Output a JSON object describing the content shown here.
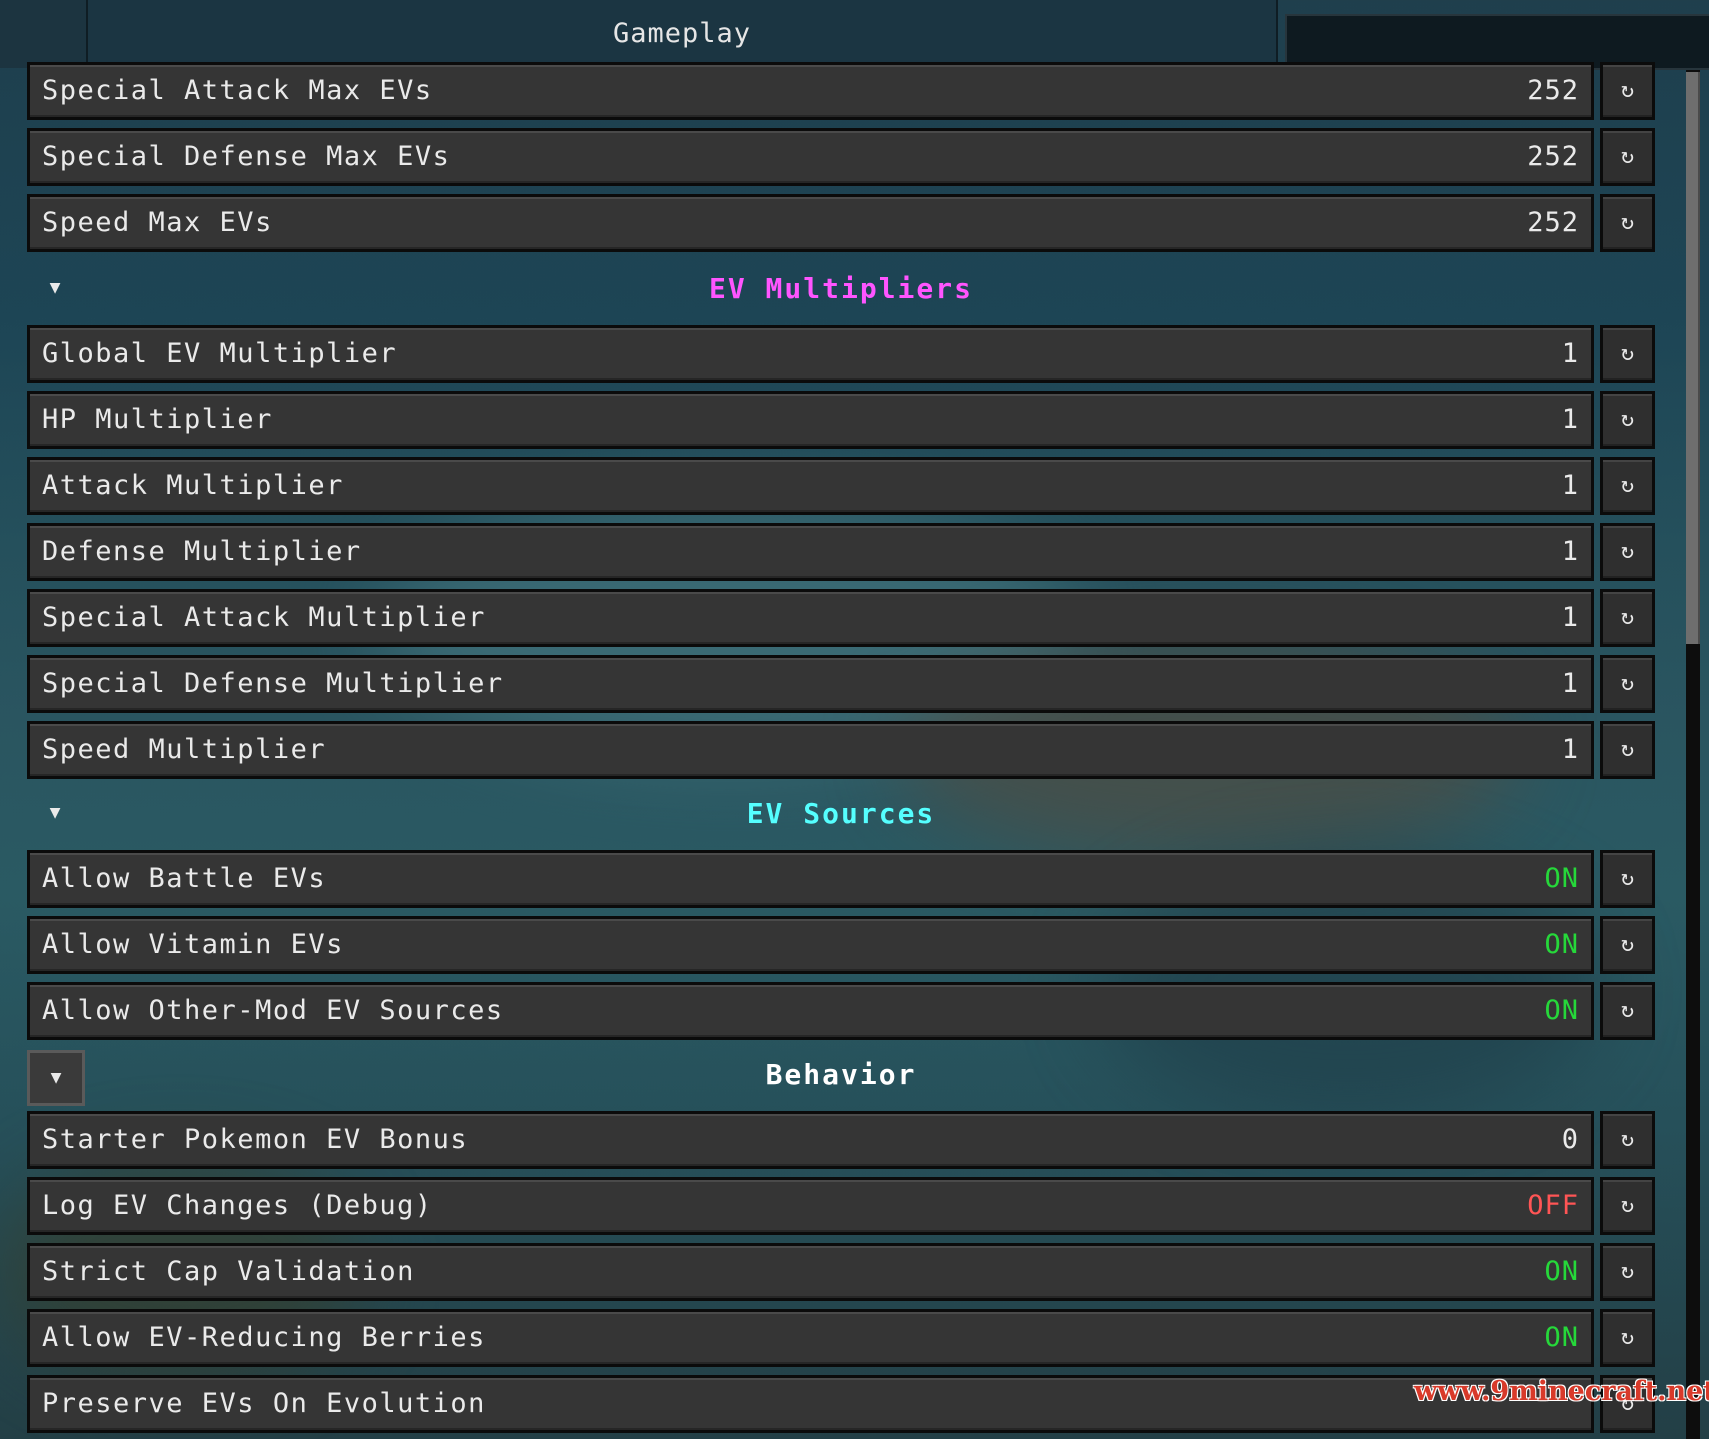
{
  "tabs": {
    "active_label": "Gameplay"
  },
  "rows_top": [
    {
      "label": "Special Attack Max EVs",
      "value": "252",
      "state": "num"
    },
    {
      "label": "Special Defense Max EVs",
      "value": "252",
      "state": "num"
    },
    {
      "label": "Speed Max EVs",
      "value": "252",
      "state": "num"
    }
  ],
  "sections": {
    "multipliers": {
      "title": "EV Multipliers",
      "color": "#ff55ff"
    },
    "sources": {
      "title": "EV Sources",
      "color": "#55ffff"
    },
    "behavior": {
      "title": "Behavior",
      "color": "#ffffff"
    }
  },
  "rows_multipliers": [
    {
      "label": "Global EV Multiplier",
      "value": "1",
      "state": "num"
    },
    {
      "label": "HP Multiplier",
      "value": "1",
      "state": "num"
    },
    {
      "label": "Attack Multiplier",
      "value": "1",
      "state": "num"
    },
    {
      "label": "Defense Multiplier",
      "value": "1",
      "state": "num"
    },
    {
      "label": "Special Attack Multiplier",
      "value": "1",
      "state": "num"
    },
    {
      "label": "Special Defense Multiplier",
      "value": "1",
      "state": "num"
    },
    {
      "label": "Speed Multiplier",
      "value": "1",
      "state": "num"
    }
  ],
  "rows_sources": [
    {
      "label": "Allow Battle EVs",
      "value": "ON",
      "state": "on"
    },
    {
      "label": "Allow Vitamin EVs",
      "value": "ON",
      "state": "on"
    },
    {
      "label": "Allow Other-Mod EV Sources",
      "value": "ON",
      "state": "on"
    }
  ],
  "rows_behavior": [
    {
      "label": "Starter Pokemon EV Bonus",
      "value": "0",
      "state": "num"
    },
    {
      "label": "Log EV Changes (Debug)",
      "value": "OFF",
      "state": "off"
    },
    {
      "label": "Strict Cap Validation",
      "value": "ON",
      "state": "on"
    },
    {
      "label": "Allow EV-Reducing Berries",
      "value": "ON",
      "state": "on"
    },
    {
      "label": "Preserve EVs On Evolution",
      "value": "",
      "state": "on"
    }
  ],
  "icons": {
    "reset": "reset-icon",
    "collapse": "collapse-arrow-icon"
  },
  "watermark": "www.9minecraft.net"
}
